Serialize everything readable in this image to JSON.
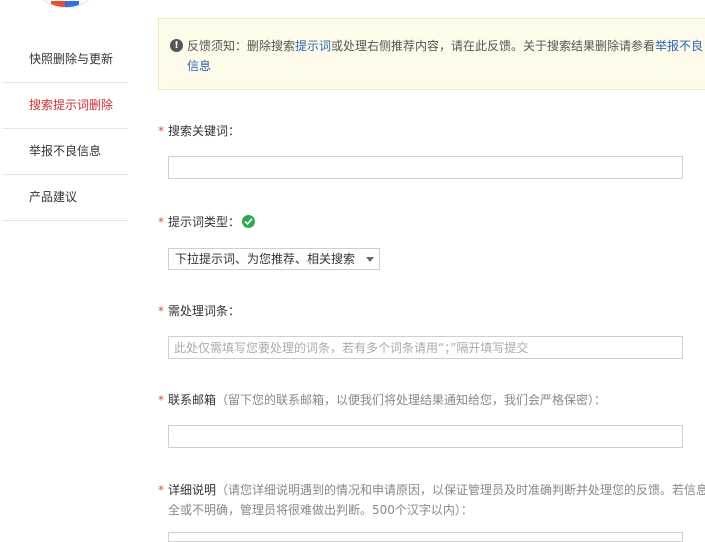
{
  "sidebar": {
    "items": [
      {
        "label": "快照删除与更新",
        "active": false
      },
      {
        "label": "搜索提示词删除",
        "active": true
      },
      {
        "label": "举报不良信息",
        "active": false
      },
      {
        "label": "产品建议",
        "active": false
      }
    ]
  },
  "notice": {
    "prefix": "反馈须知：删除搜索",
    "link1": "提示词",
    "middle": "或处理右侧推荐内容，请在此反馈。关于搜索结果删除请参看",
    "link2": "举报不良信息"
  },
  "form": {
    "keyword": {
      "label": "搜索关键词：",
      "value": ""
    },
    "type": {
      "label": "提示词类型：",
      "selected": "下拉提示词、为您推荐、相关搜索"
    },
    "terms": {
      "label": "需处理词条：",
      "placeholder": "此处仅需填写您要处理的词条，若有多个词条请用“；”隔开填写提交"
    },
    "email": {
      "label": "联系邮箱",
      "hint": "（留下您的联系邮箱，以便我们将处理结果通知给您，我们会严格保密）：",
      "value": ""
    },
    "detail": {
      "label": "详细说明",
      "hint": "（请您详细说明遇到的情况和申请原因，以保证管理员及时准确判断并处理您的反馈。若信息不",
      "hint2": "全或不明确，管理员将很难做出判断。500个汉字以内）："
    }
  },
  "colors": {
    "accent_red": "#c9302c",
    "link_blue": "#2d64b3",
    "notice_bg": "#fffbea",
    "check_green": "#2fa84f"
  }
}
